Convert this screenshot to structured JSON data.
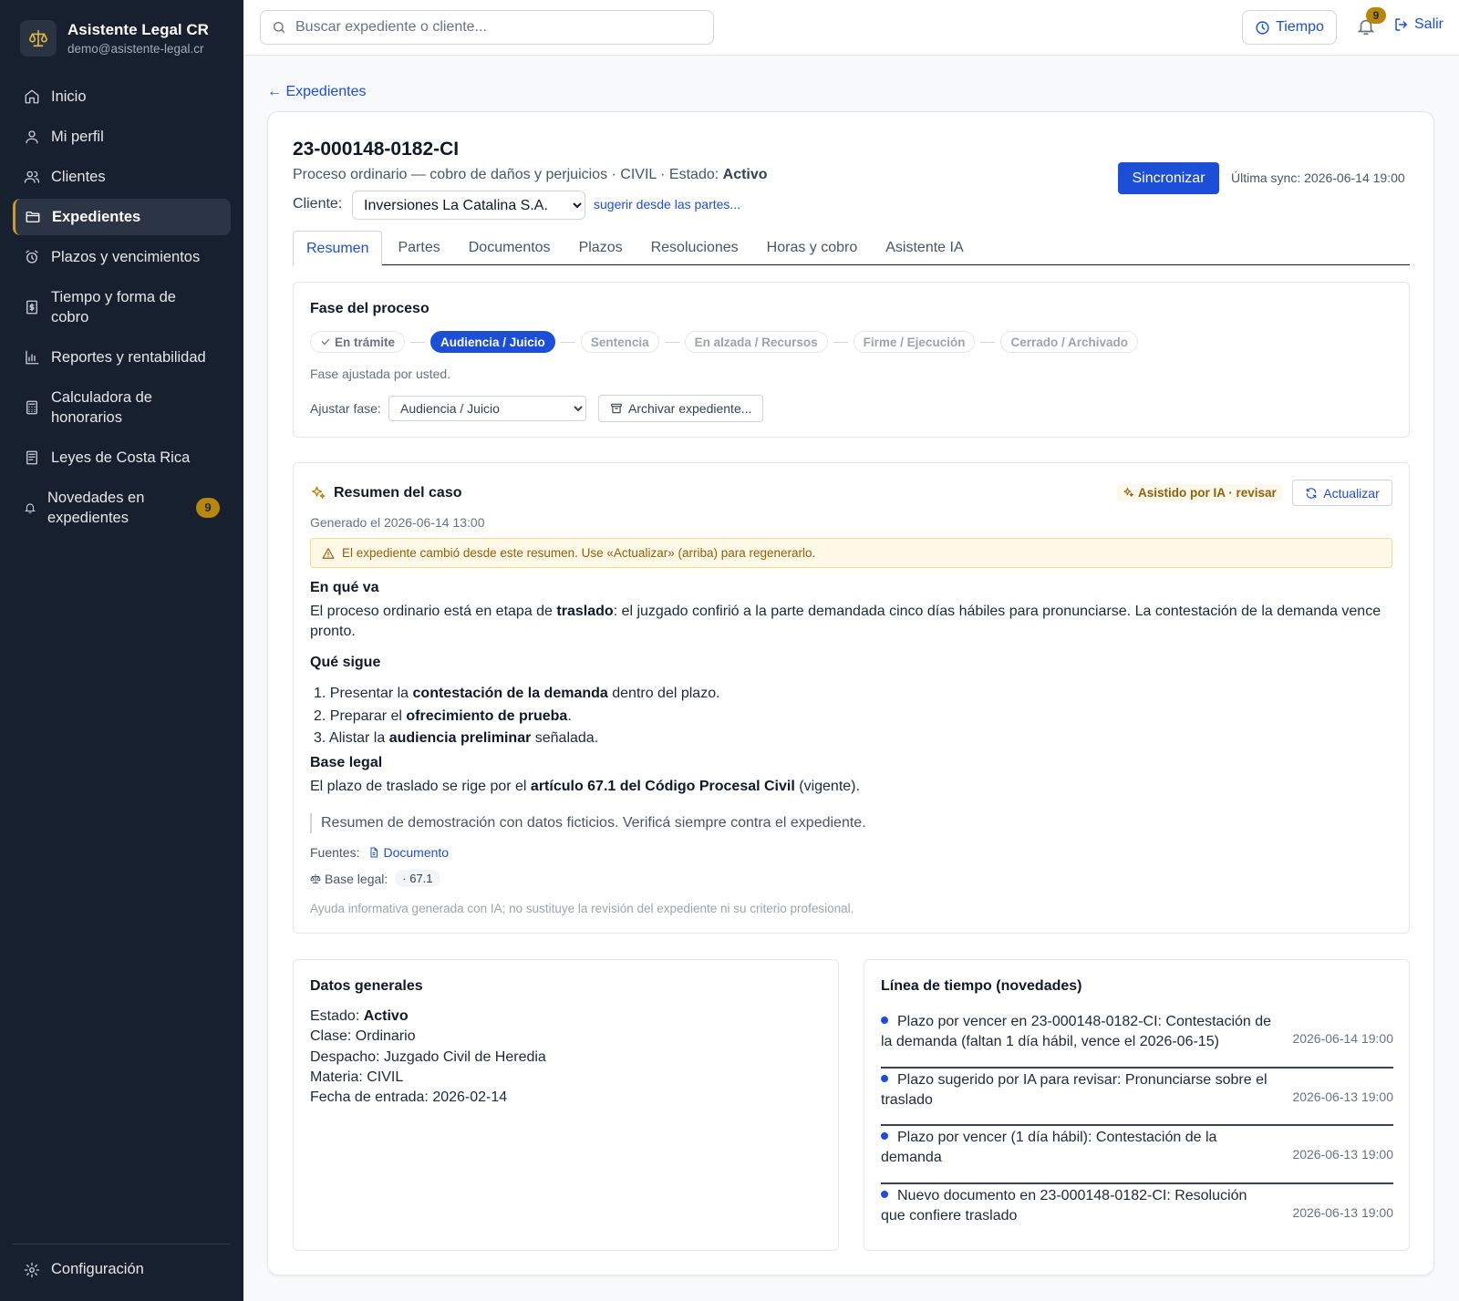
{
  "brand": {
    "name": "Asistente Legal CR",
    "email": "demo@asistente-legal.cr",
    "icon": "scales-icon"
  },
  "sidebar": {
    "items": [
      {
        "label": "Inicio",
        "icon": "home-icon"
      },
      {
        "label": "Mi perfil",
        "icon": "user-icon"
      },
      {
        "label": "Clientes",
        "icon": "users-icon"
      },
      {
        "label": "Expedientes",
        "icon": "folder-icon",
        "active": true
      },
      {
        "label": "Plazos y vencimientos",
        "icon": "alarm-clock-icon"
      },
      {
        "label": "Tiempo y forma de cobro",
        "icon": "receipt-icon"
      },
      {
        "label": "Reportes y rentabilidad",
        "icon": "bar-chart-icon"
      },
      {
        "label": "Calculadora de honorarios",
        "icon": "calculator-icon"
      },
      {
        "label": "Leyes de Costa Rica",
        "icon": "book-icon"
      },
      {
        "label": "Novedades en expedientes",
        "icon": "bell-icon",
        "badge": "9"
      }
    ],
    "settings_label": "Configuración"
  },
  "topbar": {
    "search_placeholder": "Buscar expediente o cliente...",
    "tiempo_label": "Tiempo",
    "notifications_count": "9",
    "logout_label": "Salir"
  },
  "main": {
    "back_label": "← Expedientes",
    "case_number": "23-000148-0182-CI",
    "case_sub_prefix": "Proceso ordinario — cobro de daños y perjuicios · CIVIL · Estado: ",
    "case_status": "Activo",
    "client_label": "Cliente:",
    "client_value": "Inversiones La Catalina S.A.",
    "suggest_label": "sugerir desde las partes...",
    "sync_label": "Sincronizar",
    "last_sync": "Última sync: 2026-06-14 19:00",
    "tabs": [
      "Resumen",
      "Partes",
      "Documentos",
      "Plazos",
      "Resoluciones",
      "Horas y cobro",
      "Asistente IA"
    ],
    "active_tab": "Resumen"
  },
  "fase": {
    "title": "Fase del proceso",
    "phases": [
      "En trámite",
      "Audiencia / Juicio",
      "Sentencia",
      "En alzada / Recursos",
      "Firme / Ejecución",
      "Cerrado / Archivado"
    ],
    "note": "Fase ajustada por usted.",
    "adjust_label": "Ajustar fase:",
    "adjust_value": "Audiencia / Juicio",
    "archive_label": "Archivar expediente..."
  },
  "resumen": {
    "title": "Resumen del caso",
    "ai_badge": "Asistido por IA · revisar",
    "update_label": "Actualizar",
    "generated": "Generado el 2026-06-14 13:00",
    "warning": "El expediente cambió desde este resumen. Use «Actualizar» (arriba) para regenerarlo.",
    "s1_title": "En qué va",
    "s1_a": "El proceso ordinario está en etapa de ",
    "s1_b": "traslado",
    "s1_c": ": el juzgado confirió a la parte demandada cinco días hábiles para pronunciarse. La contestación de la demanda vence pronto.",
    "s2_title": "Qué sigue",
    "steps": [
      {
        "n": "1.",
        "a": "Presentar la ",
        "b": "contestación de la demanda",
        "c": " dentro del plazo."
      },
      {
        "n": "2.",
        "a": "Preparar el ",
        "b": "ofrecimiento de prueba",
        "c": "."
      },
      {
        "n": "3.",
        "a": "Alistar la ",
        "b": "audiencia preliminar",
        "c": " señalada."
      }
    ],
    "s3_title": "Base legal",
    "s3_a": "El plazo de traslado se rige por el ",
    "s3_b": "artículo 67.1 del Código Procesal Civil",
    "s3_c": " (vigente).",
    "quote": "Resumen de demostración con datos ficticios. Verificá siempre contra el expediente.",
    "sources_label": "Fuentes:",
    "source_doc": "Documento",
    "legal_label": "Base legal:",
    "legal_chip": "· 67.1",
    "disclaimer": "Ayuda informativa generada con IA; no sustituye la revisión del expediente ni su criterio profesional."
  },
  "datos": {
    "title": "Datos generales",
    "rows": [
      {
        "label": "Estado: ",
        "value": "Activo",
        "bold": true
      },
      {
        "label": "Clase: ",
        "value": "Ordinario"
      },
      {
        "label": "Despacho: ",
        "value": "Juzgado Civil de Heredia"
      },
      {
        "label": "Materia: ",
        "value": "CIVIL"
      },
      {
        "label": "Fecha de entrada: ",
        "value": "2026-02-14"
      }
    ]
  },
  "timeline": {
    "title": "Línea de tiempo (novedades)",
    "items": [
      {
        "text": "Plazo por vencer en 23-000148-0182-CI: Contestación de la demanda (faltan 1 día hábil, vence el 2026-06-15)",
        "date": "2026-06-14 19:00"
      },
      {
        "text": "Plazo sugerido por IA para revisar: Pronunciarse sobre el traslado",
        "date": "2026-06-13 19:00"
      },
      {
        "text": "Plazo por vencer (1 día hábil): Contestación de la demanda",
        "date": "2026-06-13 19:00"
      },
      {
        "text": "Nuevo documento en 23-000148-0182-CI: Resolución que confiere traslado",
        "date": "2026-06-13 19:00"
      }
    ]
  },
  "colors": {
    "sidebar_bg": "#17202e",
    "accent": "#1d4ed8",
    "gold": "#b8860b",
    "warning_bg": "#fef9e6"
  }
}
